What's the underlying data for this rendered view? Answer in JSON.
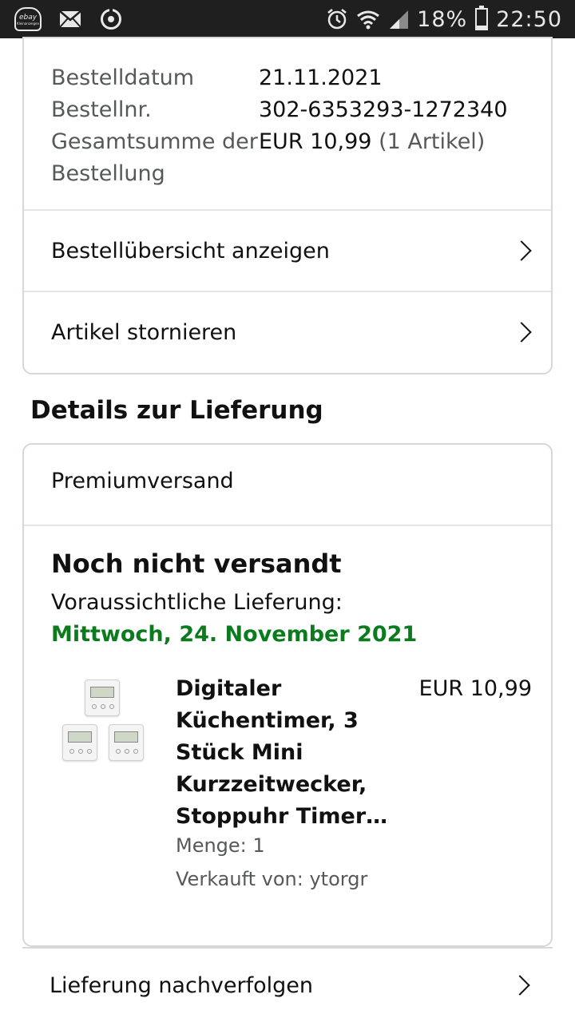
{
  "status_bar": {
    "ebay_line1": "ebay",
    "ebay_line2": "Kleinanzeigen",
    "battery_text": "18%",
    "battery_level": 0.18,
    "time": "22:50",
    "icons": [
      "ebay-kleinanzeigen-icon",
      "mail-icon",
      "sync-icon",
      "alarm-icon",
      "wifi-icon",
      "signal-icon",
      "battery-icon"
    ]
  },
  "order": {
    "rows": [
      {
        "label": "Bestelldatum",
        "value": "21.11.2021",
        "extra": ""
      },
      {
        "label": "Bestellnr.",
        "value": "302-6353293-1272340",
        "extra": ""
      },
      {
        "label": "Gesamtsumme der Bestellung",
        "value": "EUR 10,99",
        "extra": "(1 Artikel)"
      }
    ],
    "view_summary": "Bestellübersicht anzeigen",
    "cancel_items": "Artikel stornieren"
  },
  "delivery": {
    "section_title": "Details zur Lieferung",
    "shipping_method": "Premiumversand",
    "status": "Noch nicht versandt",
    "eta_label": "Voraussichtliche Lieferung:",
    "eta_date": "Mittwoch, 24. November 2021",
    "eta_color": "#0b7b1e",
    "product": {
      "title": "Digitaler Küchentimer, 3 Stück Mini Kurzzeitwecker, Stoppuhr Timer…",
      "price": "EUR 10,99",
      "quantity": "Menge: 1",
      "seller": "Verkauft von: ytorgr"
    },
    "track": "Lieferung nachverfolgen"
  }
}
